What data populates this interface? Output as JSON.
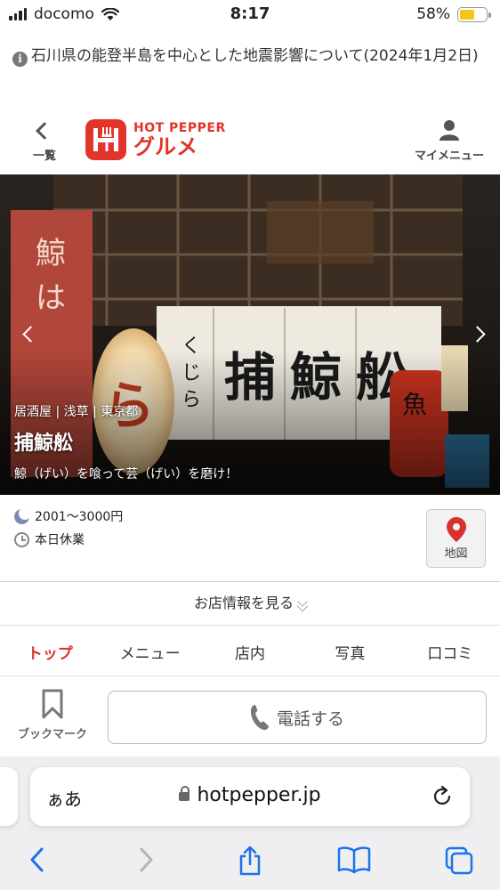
{
  "status_bar": {
    "carrier": "docomo",
    "time": "8:17",
    "battery": "58%",
    "battery_level": 0.58
  },
  "notice": {
    "text": "石川県の能登半島を中心とした地震影響について(2024年1月2日)"
  },
  "header": {
    "back_label": "一覧",
    "logo_top": "HOT PEPPER",
    "logo_bottom": "グルメ",
    "mymenu_label": "マイメニュー"
  },
  "hero": {
    "category": "居酒屋 | 浅草 | 東京都",
    "name": "捕鯨舩",
    "catch": "鯨（げい）を喰って芸（げい）を磨け！"
  },
  "details": {
    "budget": "2001〜3000円",
    "hours": "本日休業",
    "map_label": "地図"
  },
  "shop_info": {
    "label": "お店情報を見る"
  },
  "tabs": [
    {
      "label": "トップ",
      "active": true
    },
    {
      "label": "メニュー",
      "active": false
    },
    {
      "label": "店内",
      "active": false
    },
    {
      "label": "写真",
      "active": false
    },
    {
      "label": "口コミ",
      "active": false
    }
  ],
  "actions": {
    "bookmark_label": "ブックマーク",
    "call_label": "電話する"
  },
  "browser": {
    "aa_label": "ぁあ",
    "url": "hotpepper.jp"
  },
  "colors": {
    "accent": "#d7322c",
    "brand": "#e1352c"
  }
}
